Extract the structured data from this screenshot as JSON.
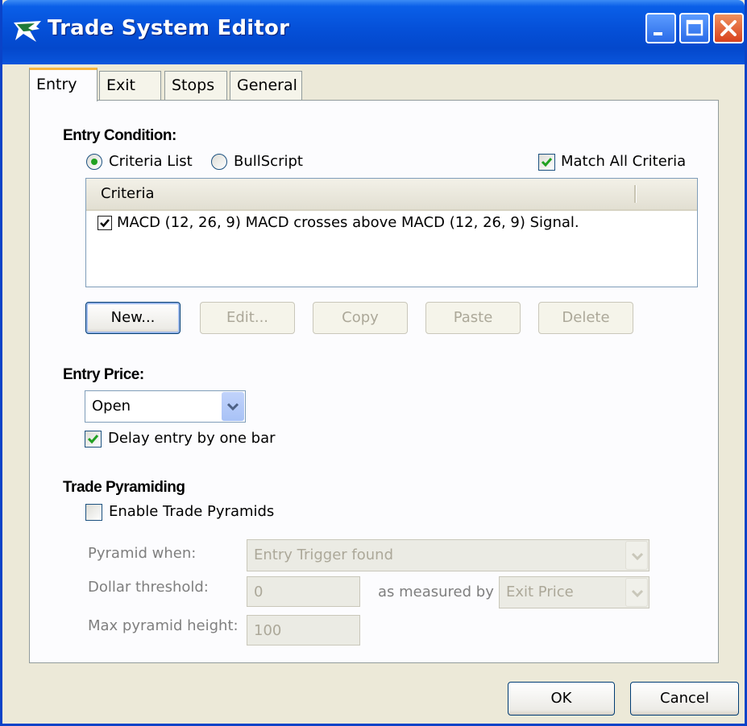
{
  "window": {
    "title": "Trade System Editor",
    "icon": "bullcharts-logo-icon"
  },
  "tabs": [
    {
      "label": "Entry",
      "active": true
    },
    {
      "label": "Exit",
      "active": false
    },
    {
      "label": "Stops",
      "active": false
    },
    {
      "label": "General",
      "active": false
    }
  ],
  "entry_condition": {
    "title": "Entry Condition:",
    "radio_criteria_label": "Criteria List",
    "radio_criteria_selected": true,
    "radio_bullscript_label": "BullScript",
    "radio_bullscript_selected": false,
    "match_all_label": "Match All Criteria",
    "match_all_checked": true,
    "list_header": "Criteria",
    "rows": [
      {
        "checked": true,
        "text": "MACD (12, 26, 9) MACD crosses above MACD (12, 26, 9) Signal."
      }
    ],
    "buttons": {
      "new": "New...",
      "edit": "Edit...",
      "copy": "Copy",
      "paste": "Paste",
      "delete": "Delete"
    }
  },
  "entry_price": {
    "title": "Entry Price:",
    "selected": "Open",
    "delay_label": "Delay entry by one bar",
    "delay_checked": true
  },
  "pyramiding": {
    "title": "Trade Pyramiding",
    "enable_label": "Enable Trade Pyramids",
    "enable_checked": false,
    "pyramid_when_label": "Pyramid when:",
    "pyramid_when_value": "Entry Trigger found",
    "dollar_threshold_label": "Dollar threshold:",
    "dollar_threshold_value": "0",
    "measured_by_label": "as measured by",
    "measured_by_value": "Exit Price",
    "max_height_label": "Max pyramid height:",
    "max_height_value": "100"
  },
  "footer": {
    "ok": "OK",
    "cancel": "Cancel"
  },
  "colors": {
    "titlebar": "#0550D8",
    "face": "#ECE9D8",
    "panel": "#FCFCFE",
    "check_green": "#21A121",
    "active_tab_accent": "#F8B640"
  }
}
